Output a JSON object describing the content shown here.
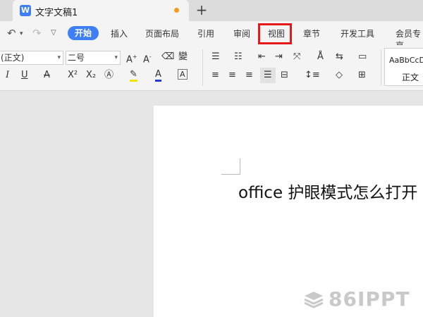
{
  "tab": {
    "title": "文字文稿1",
    "icon": "W"
  },
  "menu": {
    "items": [
      "开始",
      "插入",
      "页面布局",
      "引用",
      "审阅",
      "视图",
      "章节",
      "开发工具",
      "会员专享"
    ],
    "active": "开始",
    "highlighted": "视图"
  },
  "toolbar": {
    "font_name": "(正文)",
    "font_size": "二号",
    "style_sample": "AaBbCcD",
    "style_name": "正文"
  },
  "document": {
    "text_en": "office",
    "text_zh": " 护眼模式怎么打开"
  },
  "watermark": "86IPPT",
  "colors": {
    "accent": "#3f7ff6",
    "highlight_border": "#e3191a",
    "unsaved_dot": "#f39a1d"
  }
}
